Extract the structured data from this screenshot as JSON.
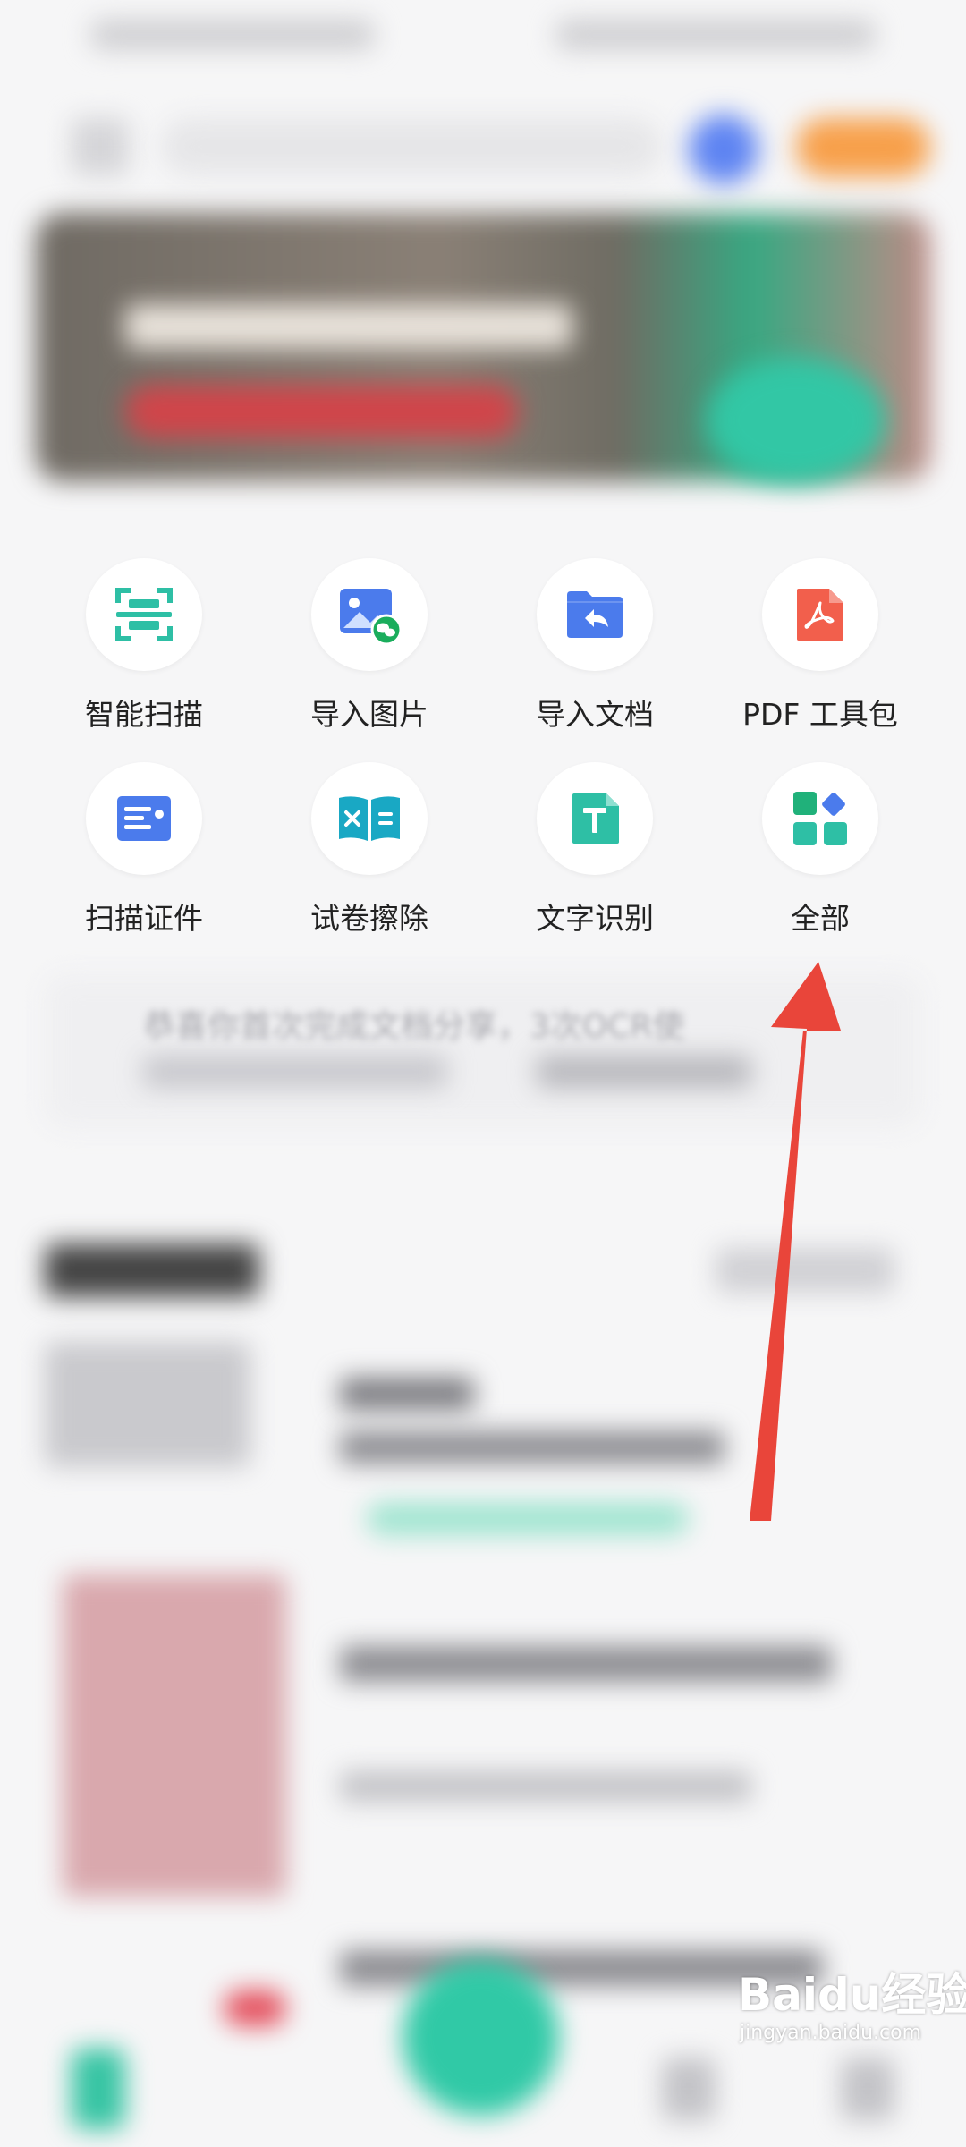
{
  "tools": [
    {
      "label": "智能扫描",
      "icon": "scan-icon"
    },
    {
      "label": "导入图片",
      "icon": "import-image-icon"
    },
    {
      "label": "导入文档",
      "icon": "import-document-icon"
    },
    {
      "label": "PDF 工具包",
      "icon": "pdf-icon"
    },
    {
      "label": "扫描证件",
      "icon": "id-card-icon"
    },
    {
      "label": "试卷擦除",
      "icon": "exam-erase-icon"
    },
    {
      "label": "文字识别",
      "icon": "text-recognition-icon"
    },
    {
      "label": "全部",
      "icon": "all-apps-icon"
    }
  ],
  "notice": {
    "text": "恭喜你首次完成文档分享，3次OCR使"
  },
  "watermark": {
    "logo": "Baidu经验",
    "sub": "jingyan.baidu.com"
  },
  "colors": {
    "teal": "#2ebfa5",
    "blue": "#4b7bec",
    "pdf_orange": "#f25f4c",
    "annotation_red": "#e9453a",
    "all_green": "#20b17a"
  }
}
